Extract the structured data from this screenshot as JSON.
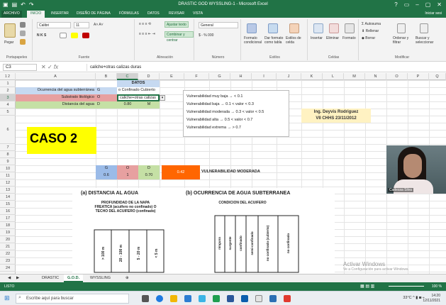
{
  "window": {
    "title": "DRASTIC GOD WYSSLING-1 - Microsoft Excel",
    "signin": "Iniciar sesi"
  },
  "ribbon_tabs": [
    "ARCHIVO",
    "INICIO",
    "INSERTAR",
    "DISEÑO DE PÁGINA",
    "FÓRMULAS",
    "DATOS",
    "REVISAR",
    "VISTA"
  ],
  "ribbon": {
    "paste_label": "Pegar",
    "font_name": "Calibri",
    "font_size": "11",
    "bold_italic": "N K S",
    "wrap_text": "Ajustar texto",
    "merge_center": "Combinar y centrar",
    "number_format": "General",
    "number_marks": "$ - % 000",
    "cond_format": "Formato condicional",
    "format_table": "Dar formato como tabla",
    "cell_styles": "Estilos de celda",
    "insert": "Insertar",
    "delete": "Eliminar",
    "format": "Formato",
    "autosum": "Autosuma",
    "fill": "Rellenar",
    "clear": "Borrar",
    "sort_filter": "Ordenar y filtrar",
    "find_select": "Buscar y seleccionar",
    "groups": [
      "Portapapeles",
      "Fuente",
      "Alineación",
      "Número",
      "Estilos",
      "Celdas",
      "Modificar"
    ]
  },
  "formula_bar": {
    "name_box": "C3",
    "fx": "fx",
    "formula": "caliche+otras calizas duras"
  },
  "columns": [
    "A",
    "B",
    "C",
    "D",
    "E",
    "F",
    "G",
    "H",
    "I",
    "J",
    "K",
    "L",
    "M",
    "N",
    "O",
    "P",
    "Q"
  ],
  "rows": [
    "1",
    "2",
    "3",
    "4",
    "5",
    "6",
    "7",
    "8",
    "9",
    "10",
    "11",
    "12",
    "13",
    "14",
    "15",
    "16",
    "17",
    "18",
    "19",
    "20",
    "21",
    "22",
    "23",
    "24",
    "25",
    "26"
  ],
  "sheet": {
    "datos_header": "DATOS",
    "row2_label": "Ocurrencia del agua subterránea",
    "row2_key": "G",
    "row2_value": "o Confinado Cubierto",
    "row3_label": "Substrato litológico",
    "row3_key": "O",
    "row3_value": "caliche+otras calizas",
    "row4_label": "Distancia del agua",
    "row4_key": "D",
    "row4_value": "0.80",
    "row4_unit": "M",
    "caso": "CASO 2",
    "row9_g": "G",
    "row9_o": "O",
    "row9_d": "D",
    "row10_g": "0.6",
    "row10_o": "1",
    "row10_d": "0.70",
    "result_value": "0.42",
    "result_label": "VULNERABILIDAD MODERADA",
    "vulnerability_scale": [
      "Vulnerabilidad muy baja → < 0.1",
      "Vulnerabilidad baja → 0.1 < valor < 0.3",
      "Vulnerabilidad moderada → 0.3 < valor < 0.5",
      "Vulnerabilidad alta → 0.5 < valor < 0.7",
      "Vulnerabilidad extrema → > 0.7"
    ],
    "author_name": "Ing. Deyvis Rodriguez",
    "author_event": "VII CHHS 23/11/2012"
  },
  "figure": {
    "title_a": "(a)  DISTANCIA AL AGUA",
    "sub_a": "PROFUNDIDAD DE LA NAPA FREATICA (acuifero no confinado) O TECHO DEL ACUIFERO (confinado)",
    "depth_labels": [
      "> 100 m",
      "20 - 100 m",
      "5 - 20 m",
      "< 5 m"
    ],
    "title_b": "(b)  OCURRENCIA DE AGUA SUBTERRANEA",
    "sub_b": "CONDICION DEL ACUIFERO",
    "aquifer_labels": [
      "ninguna",
      "surgente",
      "confinado",
      "semi-confinado",
      "no confinado (cubierto)",
      "no confinado"
    ]
  },
  "webcam": {
    "name": "Carlessa Silva"
  },
  "sheet_tabs": [
    "DRASTIC",
    "G.O.D.",
    "WYSSLING"
  ],
  "active_sheet": "G.O.D.",
  "windows_watermark": {
    "line1": "Activar Windows",
    "line2": "Ve a Configuración para activar Windows."
  },
  "status": {
    "mode": "LISTO",
    "zoom": "100 %"
  },
  "taskbar": {
    "search_placeholder": "Escribe aquí para buscar",
    "weather": "33°C",
    "time": "14:20",
    "date": "12/11/2021"
  },
  "colors": {
    "excel_green": "#217346",
    "header_fill": "#c6d9f1",
    "yellow": "#ffff00",
    "orange": "#ff6600",
    "key_g": "#9bbbe8",
    "key_o": "#e7a0a0",
    "key_d": "#c5e0a5",
    "author_fill": "#fff2c2"
  }
}
